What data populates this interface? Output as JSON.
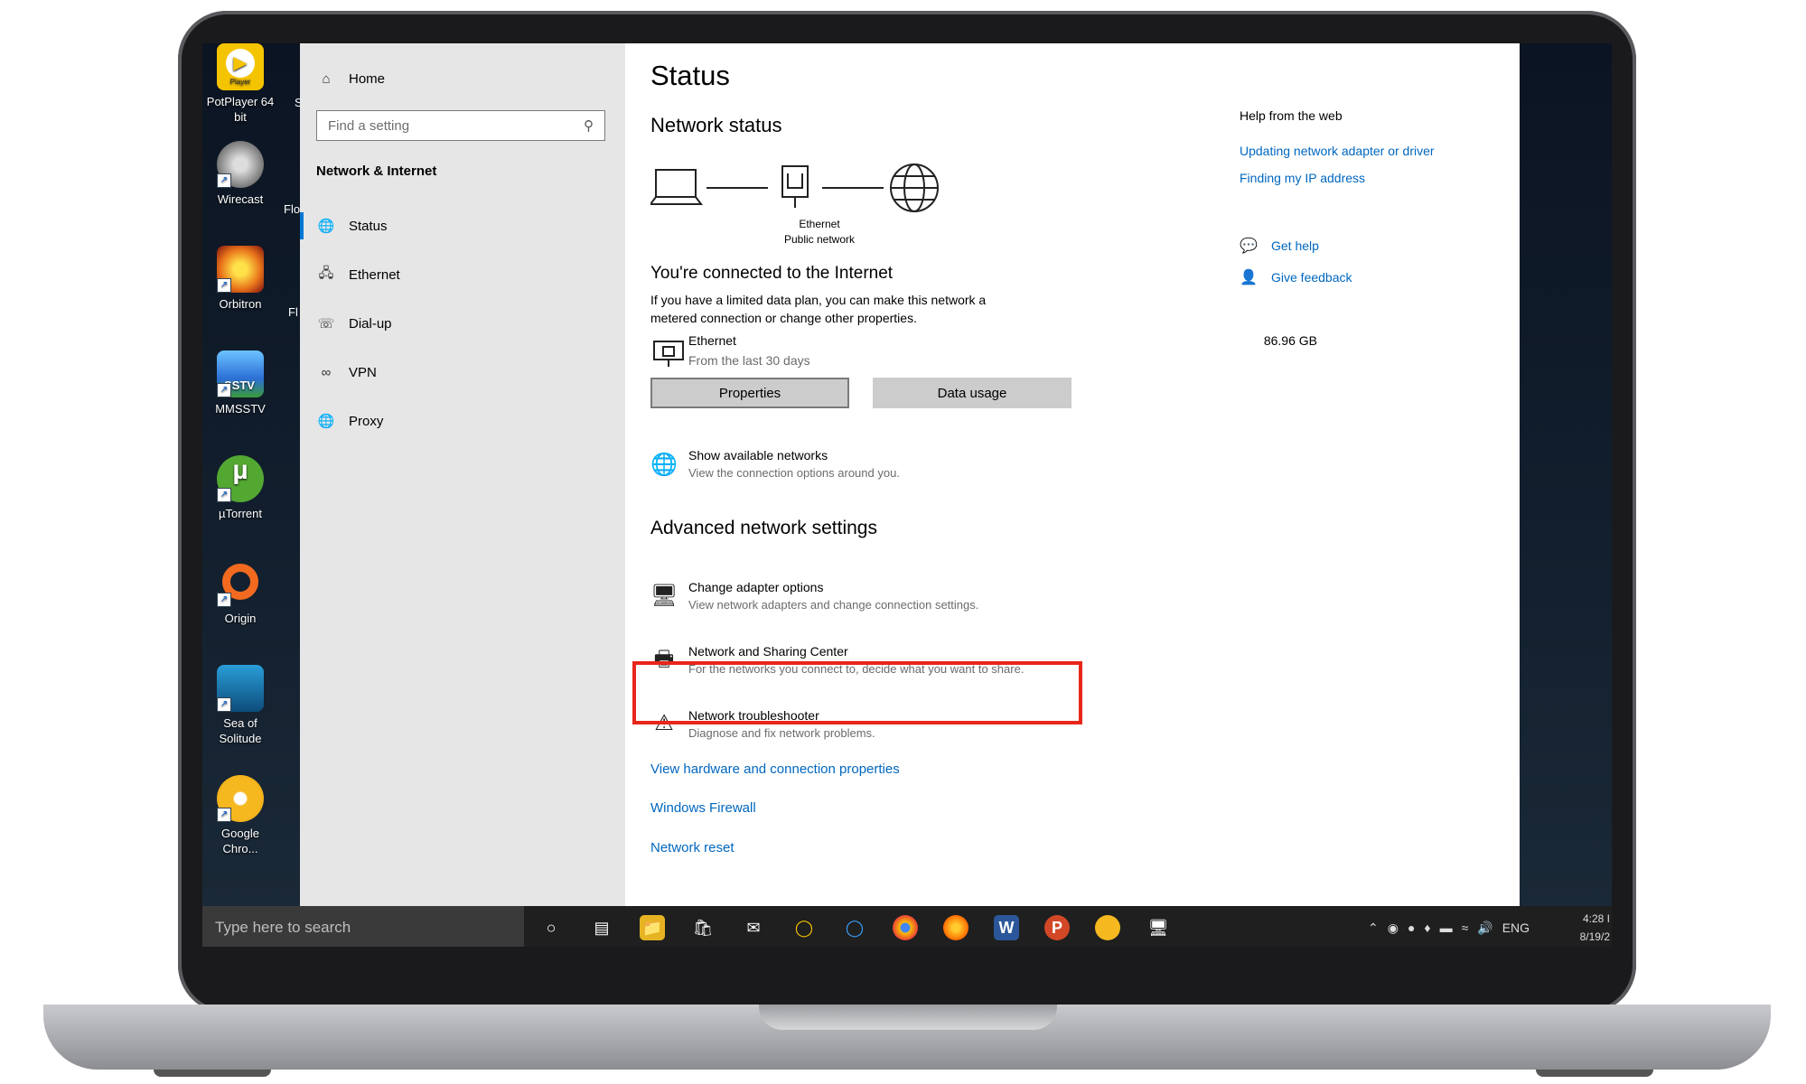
{
  "desktop": {
    "icons": [
      {
        "label": "PotPlayer 64 bit",
        "badge": "Player",
        "color": "#f5c400"
      },
      {
        "label": "Wirecast",
        "color": "#8a8a8a"
      },
      {
        "label": "Orbitron",
        "color": "#e8731a"
      },
      {
        "label": "MMSSTV",
        "badge": "SSTV",
        "color": "#2c6fd6"
      },
      {
        "label": "µTorrent",
        "color": "#53a832"
      },
      {
        "label": "Origin",
        "color": "#f26a20"
      },
      {
        "label": "Sea of Solitude",
        "color": "#1c7bb8"
      },
      {
        "label": "Google Chro...",
        "color": "#f5b81f"
      }
    ],
    "partial_labels": [
      "S",
      "Flo",
      "Fl"
    ]
  },
  "nav": {
    "home": "Home",
    "search_placeholder": "Find a setting",
    "section_title": "Network & Internet",
    "items": [
      {
        "label": "Status",
        "icon": "globe-icon"
      },
      {
        "label": "Ethernet",
        "icon": "ethernet-icon"
      },
      {
        "label": "Dial-up",
        "icon": "dialup-icon"
      },
      {
        "label": "VPN",
        "icon": "vpn-icon"
      },
      {
        "label": "Proxy",
        "icon": "proxy-icon"
      }
    ],
    "selected": "Status"
  },
  "main": {
    "title": "Status",
    "network_status_heading": "Network status",
    "diagram": {
      "device_label": "Ethernet",
      "network_label": "Public network"
    },
    "connected_heading": "You're connected to the Internet",
    "connected_desc_line1": "If you have a limited data plan, you can make this network a",
    "connected_desc_line2": "metered connection or change other properties.",
    "connection": {
      "name": "Ethernet",
      "period": "From the last 30 days",
      "usage": "86.96 GB"
    },
    "buttons": {
      "properties": "Properties",
      "data_usage": "Data usage"
    },
    "show_networks": {
      "title": "Show available networks",
      "desc": "View the connection options around you."
    },
    "advanced_heading": "Advanced network settings",
    "advanced_items": [
      {
        "title": "Change adapter options",
        "desc": "View network adapters and change connection settings."
      },
      {
        "title": "Network and Sharing Center",
        "desc": "For the networks you connect to, decide what you want to share."
      },
      {
        "title": "Network troubleshooter",
        "desc": "Diagnose and fix network problems."
      }
    ],
    "links": [
      "View hardware and connection properties",
      "Windows Firewall",
      "Network reset"
    ]
  },
  "help": {
    "heading": "Help from the web",
    "links": [
      "Updating network adapter or driver",
      "Finding my IP address"
    ],
    "get_help": "Get help",
    "give_feedback": "Give feedback"
  },
  "taskbar": {
    "search_placeholder": "Type here to search",
    "lang": "ENG",
    "time": "4:28 I",
    "date": "8/19/2"
  }
}
